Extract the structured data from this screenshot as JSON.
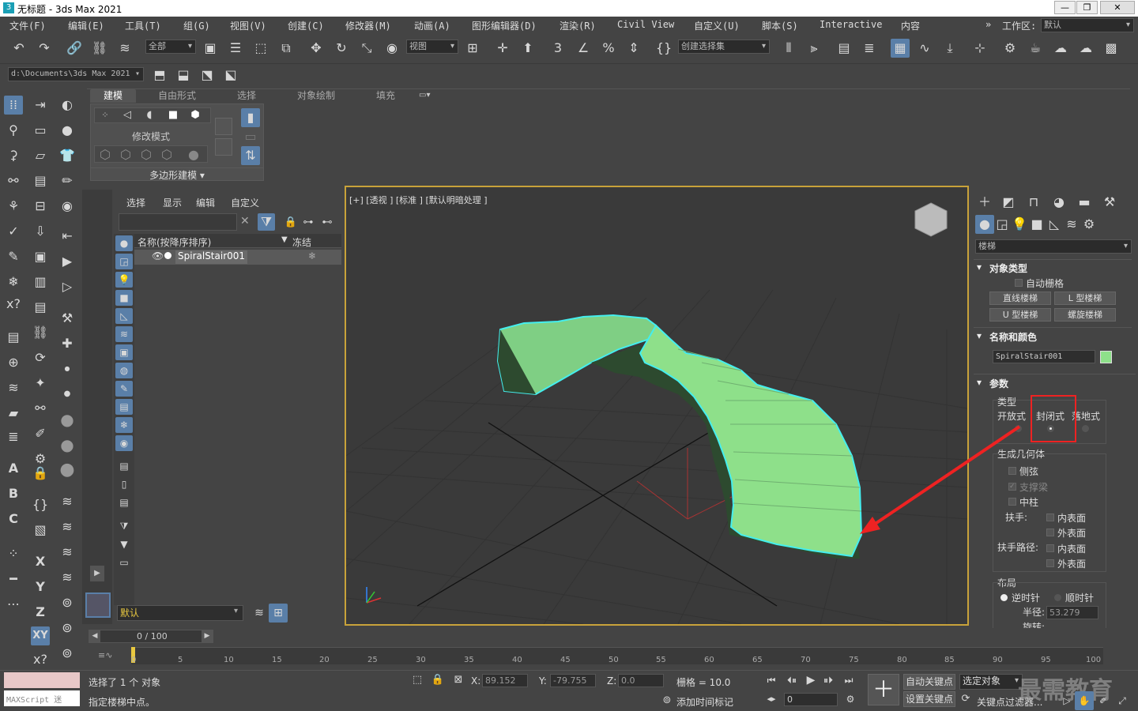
{
  "app": {
    "title": "无标题 - 3ds Max 2021",
    "logo": "3"
  },
  "window_controls": [
    "—",
    "❐",
    "✕"
  ],
  "menu": [
    "文件(F)",
    "编辑(E)",
    "工具(T)",
    "组(G)",
    "视图(V)",
    "创建(C)",
    "修改器(M)",
    "动画(A)",
    "图形编辑器(D)",
    "渲染(R)",
    "Civil View",
    "自定义(U)",
    "脚本(S)",
    "Interactive",
    "内容"
  ],
  "workspace": {
    "label": "工作区:",
    "value": "默认",
    "more": "»"
  },
  "toolbar": {
    "selection_filter": "全部",
    "ref_coord": "视图",
    "named_set": "创建选择集",
    "project_path": "d:\\Documents\\3ds Max 2021"
  },
  "ribbon": {
    "tabs": [
      "建模",
      "自由形式",
      "选择",
      "对象绘制",
      "填充"
    ],
    "active": "建模",
    "modify_mode": "修改模式",
    "poly_modeling": "多边形建模 ▾"
  },
  "scene_explorer": {
    "menus": [
      "选择",
      "显示",
      "编辑",
      "自定义"
    ],
    "col_name": "名称(按降序排序)",
    "col_freeze": "冻结",
    "items": [
      {
        "name": "SpiralStair001"
      }
    ],
    "layer": "默认"
  },
  "viewport": {
    "label": "[+] [透视 ] [标准 ] [默认明暗处理 ]"
  },
  "command_panel": {
    "category": "楼梯",
    "object_type": {
      "title": "对象类型",
      "autogrid": "自动栅格",
      "buttons": [
        "直线楼梯",
        "L 型楼梯",
        "U 型楼梯",
        "螺旋楼梯"
      ]
    },
    "name_color": {
      "title": "名称和颜色",
      "name": "SpiralStair001",
      "color": "#8ee08a"
    },
    "params": {
      "title": "参数",
      "type_label": "类型",
      "types": [
        "开放式",
        "封闭式",
        "落地式"
      ],
      "selected_type": "封闭式",
      "gen_geo": "生成几何体",
      "side_string": "侧弦",
      "support_beam": "支撑梁",
      "center_pole": "中柱",
      "handrail": "扶手:",
      "handrail_path": "扶手路径:",
      "inner": "内表面",
      "outer": "外表面",
      "layout": "布局",
      "ccw": "逆时针",
      "cw": "顺时针",
      "radius_label": "半径:",
      "radius": "53.279",
      "revs_label": "旋转:"
    }
  },
  "timeline": {
    "frame": "0 / 100",
    "ticks": [
      "0",
      "5",
      "10",
      "15",
      "20",
      "25",
      "30",
      "35",
      "40",
      "45",
      "50",
      "55",
      "60",
      "65",
      "70",
      "75",
      "80",
      "85",
      "90",
      "95",
      "100"
    ]
  },
  "status": {
    "selected": "选择了 1 个 对象",
    "prompt": "指定楼梯中点。",
    "x_label": "X:",
    "x": "89.152",
    "y_label": "Y:",
    "y": "-79.755",
    "z_label": "Z:",
    "z": "0.0",
    "grid": "栅格 = 10.0",
    "add_time_tag": "添加时间标记",
    "auto_key": "自动关键点",
    "set_key": "设置关键点",
    "selected_obj": "选定对象",
    "key_filter": "关键点过滤器...",
    "frame_field": "0",
    "maxscript": "MAXScript 迷",
    "watermark": "最需教育"
  }
}
